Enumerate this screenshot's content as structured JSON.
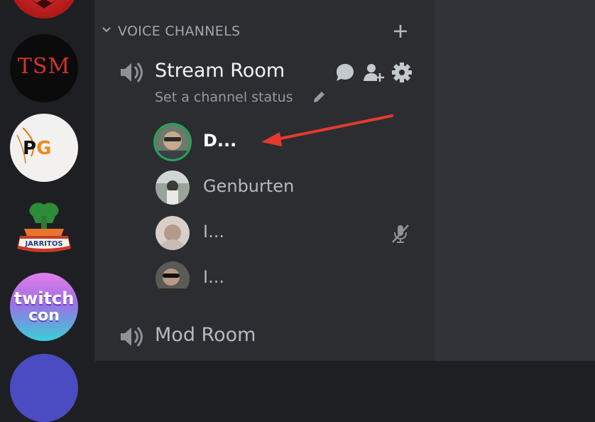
{
  "servers": [
    {
      "name": "server-red"
    },
    {
      "name": "server-tsm",
      "text": "TSM"
    },
    {
      "name": "server-pg",
      "text_p": "P",
      "text_g": "G"
    },
    {
      "name": "server-jarritos",
      "text": "JARRITOS"
    },
    {
      "name": "server-twitchcon",
      "line1": "twitch",
      "line2": "con"
    },
    {
      "name": "server-partial"
    }
  ],
  "category": {
    "label": "VOICE CHANNELS",
    "collapse_icon": "chevron-down-icon",
    "add_icon": "plus-icon"
  },
  "channels": [
    {
      "name": "Stream Room",
      "status_placeholder": "Set a channel status",
      "icons": [
        "chat-bubble-icon",
        "add-member-icon",
        "gear-icon"
      ],
      "members": [
        {
          "name": "D...",
          "speaking": true,
          "muted": false
        },
        {
          "name": "Genburten",
          "speaking": false,
          "muted": false
        },
        {
          "name": "I...",
          "speaking": false,
          "muted": true
        },
        {
          "name": "I...",
          "speaking": false,
          "muted": false
        }
      ]
    },
    {
      "name": "Mod Room"
    }
  ],
  "colors": {
    "rail": "#1e1f22",
    "panel": "#2b2d31",
    "speaking_ring": "#23a55a",
    "annotation_arrow": "#e53a2c"
  }
}
